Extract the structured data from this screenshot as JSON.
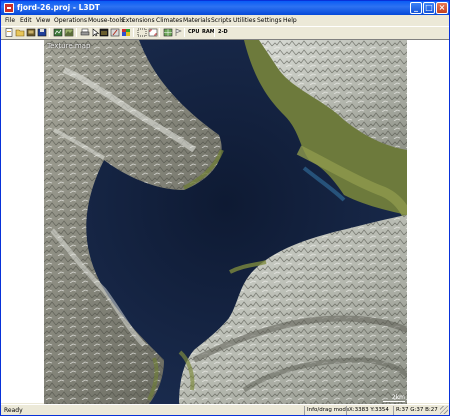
{
  "window": {
    "title": "fjord-26.proj - L3DT"
  },
  "menu": [
    "File",
    "Edit",
    "View",
    "Operations",
    "Mouse-tools",
    "Extensions",
    "Climates",
    "Materials",
    "Scripts",
    "Utilities",
    "Settings",
    "Help"
  ],
  "toolbar": {
    "cpu_label": "CPU",
    "ram_label": "RAM",
    "view_label": "2-D"
  },
  "map": {
    "label": "Texture map",
    "scale_label": "2km"
  },
  "status": {
    "ready": "Ready",
    "mode": "Info/drag mode",
    "coords": "X:3383 Y:3354",
    "color": "R:37 G:37 B:27"
  }
}
